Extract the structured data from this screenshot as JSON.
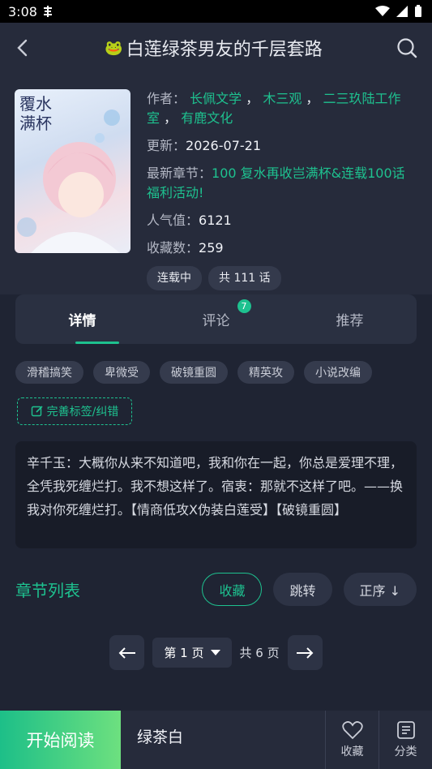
{
  "status": {
    "time": "3:08"
  },
  "appbar": {
    "title": "白莲绿茶男友的千层套路"
  },
  "book": {
    "author_label": "作者：",
    "authors": [
      "长佩文学",
      "木三观",
      "二三玖陆工作室",
      "有鹿文化"
    ],
    "update_label": "更新：",
    "update_date": "2026-07-21",
    "latest_label": "最新章节：",
    "latest_chapter": "100 复水再收岂满杯&连载100话福利活动!",
    "popularity_label": "人气值：",
    "popularity": "6121",
    "favorites_label": "收藏数：",
    "favorites": "259",
    "status_chip": "连载中",
    "episodes_chip": "共 111 话",
    "cover_text": "覆水满杯"
  },
  "tabs": [
    {
      "label": "详情",
      "active": true
    },
    {
      "label": "评论",
      "badge": "7"
    },
    {
      "label": "推荐"
    }
  ],
  "tags": [
    "滑稽搞笑",
    "卑微受",
    "破镜重圆",
    "精英攻",
    "小说改编"
  ],
  "edit_tag_label": "完善标签/纠错",
  "description": "辛千玉：大概你从来不知道吧，我和你在一起，你总是爱理不理，全凭我死缠烂打。我不想这样了。宿衷：那就不这样了吧。——换我对你死缠烂打。【情商低攻X伪装白莲受】【破镜重圆】",
  "chapters": {
    "title": "章节列表",
    "collect": "收藏",
    "jump": "跳转",
    "order": "正序 ↓"
  },
  "pager": {
    "current": "第 1 页",
    "total": "共 6 页"
  },
  "bottom": {
    "start": "开始阅读",
    "latest_title": "绿茶白",
    "favorite": "收藏",
    "category": "分类"
  },
  "colors": {
    "accent": "#1ec18f",
    "bg": "#1f2433"
  }
}
